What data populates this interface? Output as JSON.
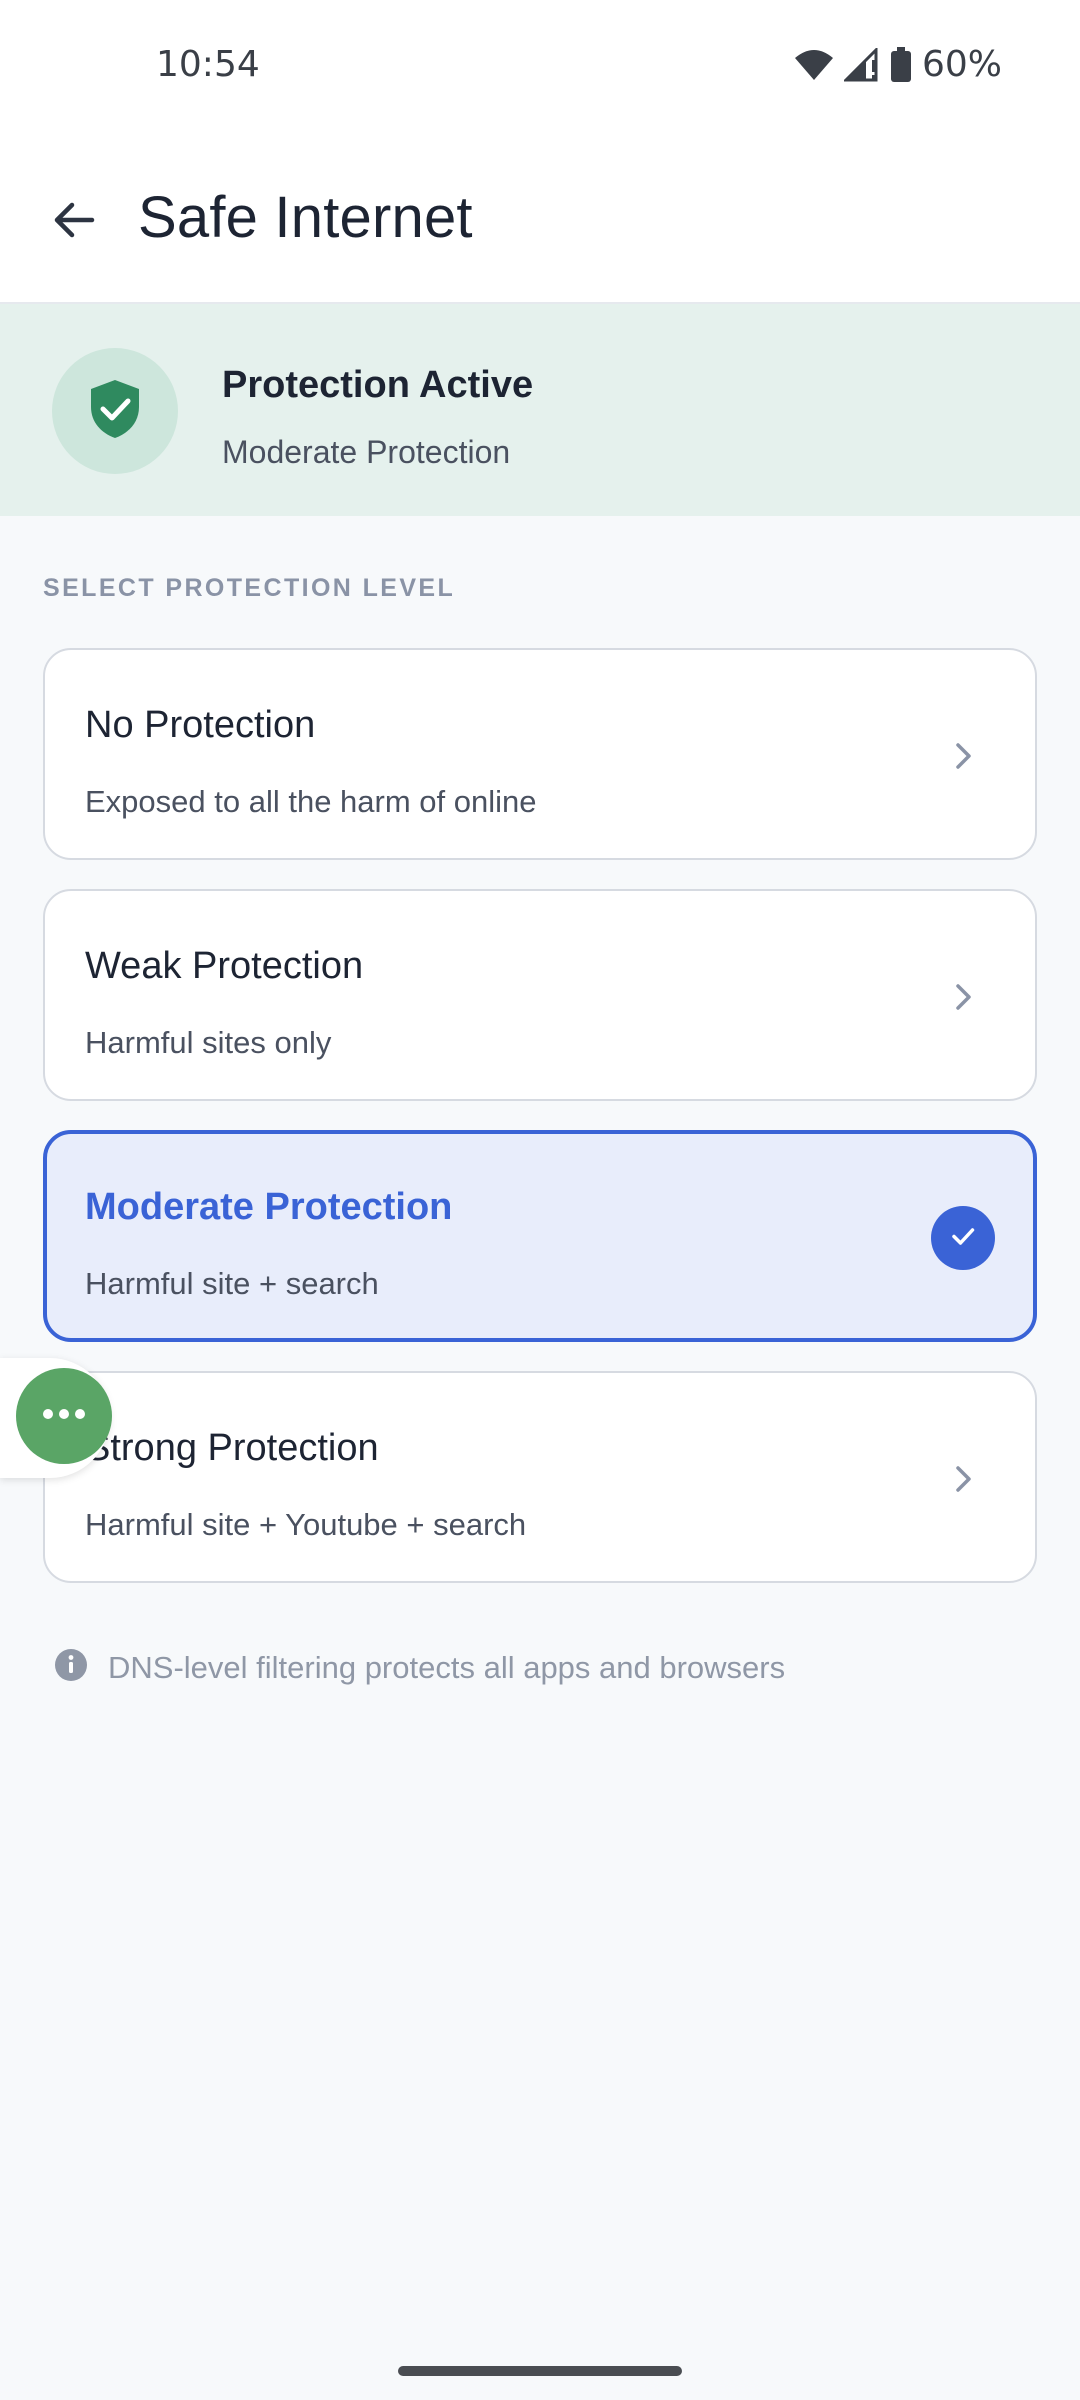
{
  "status_bar": {
    "time": "10:54",
    "battery": "60%",
    "icons": [
      "wifi-icon",
      "cell-signal-icon",
      "battery-icon"
    ]
  },
  "app_bar": {
    "title": "Safe Internet",
    "back_icon": "arrow-left-icon"
  },
  "banner": {
    "title": "Protection Active",
    "subtitle": "Moderate Protection",
    "icon": "shield-check-icon",
    "color": "#2f8a5f"
  },
  "section": {
    "header": "SELECT PROTECTION LEVEL"
  },
  "options": [
    {
      "title": "No Protection",
      "description": "Exposed to all the harm of online",
      "selected": false
    },
    {
      "title": "Weak Protection",
      "description": "Harmful sites only",
      "selected": false
    },
    {
      "title": "Moderate Protection",
      "description": "Harmful site + search",
      "selected": true
    },
    {
      "title": "Strong Protection",
      "description": "Harmful site + Youtube + search",
      "selected": false
    }
  ],
  "info": {
    "text": "DNS-level filtering protects all apps and browsers",
    "icon": "info-icon"
  },
  "fab": {
    "icon": "more-horizontal-icon",
    "color": "#5aa566"
  },
  "colors": {
    "accent": "#3a63d6",
    "banner_bg": "#e5f1ed",
    "page_bg": "#f7f9fb"
  }
}
